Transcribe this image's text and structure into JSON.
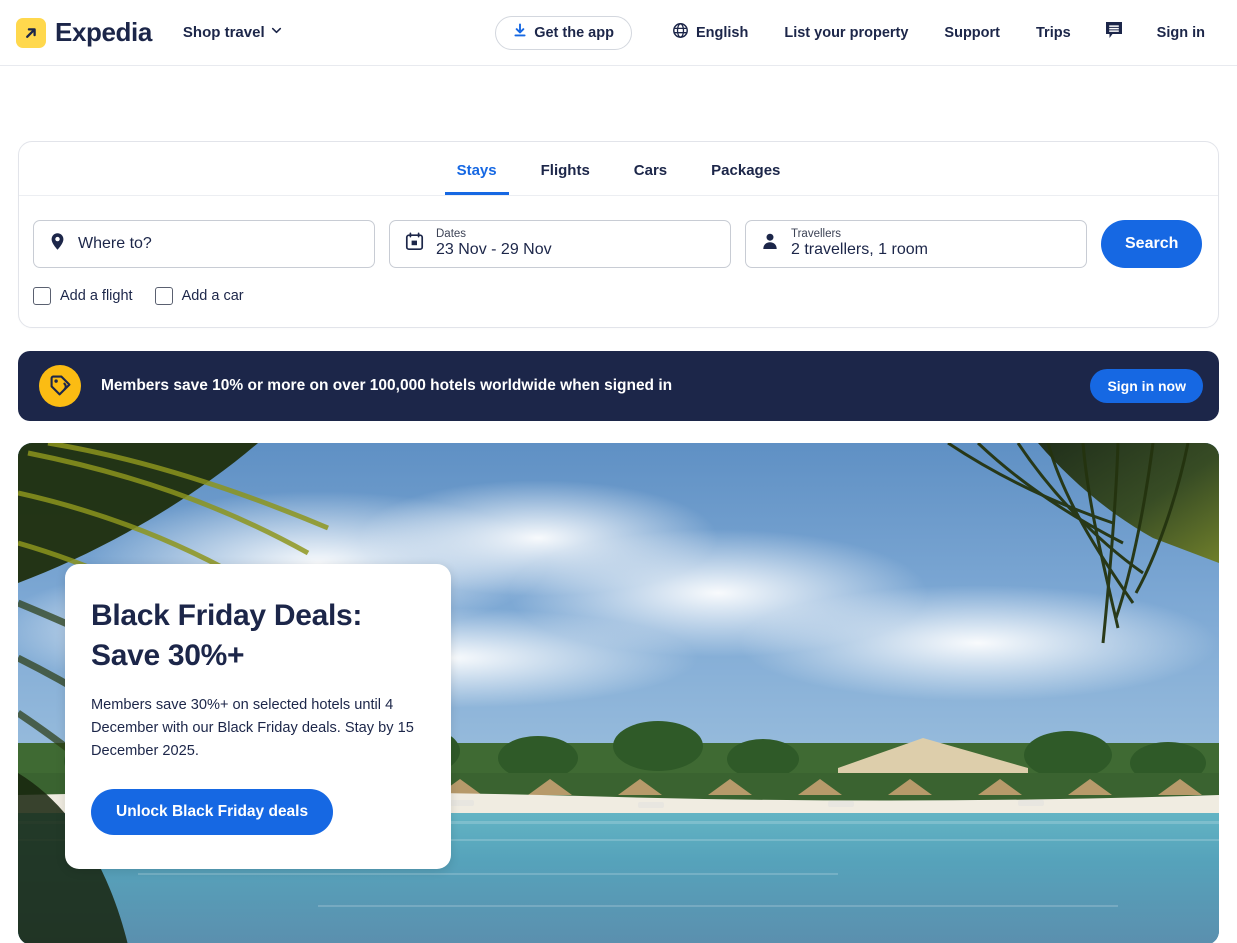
{
  "brand": {
    "name": "Expedia",
    "logo_icon": "arrow-up-right-icon",
    "logo_bg": "#ffd84d"
  },
  "header": {
    "shop_travel": "Shop travel",
    "shop_travel_icon": "chevron-down-icon",
    "get_app": "Get the app",
    "get_app_icon": "download-icon",
    "language": "English",
    "language_icon": "globe-icon",
    "list_property": "List your property",
    "support": "Support",
    "trips": "Trips",
    "messages_icon": "message-bubble-icon",
    "sign_in": "Sign in"
  },
  "search": {
    "tabs": [
      {
        "label": "Stays",
        "active": true
      },
      {
        "label": "Flights",
        "active": false
      },
      {
        "label": "Cars",
        "active": false
      },
      {
        "label": "Packages",
        "active": false
      }
    ],
    "destination": {
      "placeholder": "Where to?",
      "value": "",
      "icon": "location-pin-icon"
    },
    "dates": {
      "label": "Dates",
      "value": "23 Nov - 29 Nov",
      "icon": "calendar-icon"
    },
    "travellers": {
      "label": "Travellers",
      "value": "2 travellers, 1 room",
      "icon": "person-icon"
    },
    "search_button": "Search",
    "checkboxes": [
      {
        "label": "Add a flight",
        "checked": false
      },
      {
        "label": "Add a car",
        "checked": false
      }
    ]
  },
  "member_banner": {
    "badge_icon": "price-tag-icon",
    "text": "Members save 10% or more on over 100,000 hotels worldwide when signed in",
    "cta": "Sign in now",
    "bg": "#1c2649",
    "badge_bg": "#fbbc13"
  },
  "hero": {
    "title_line1": "Black Friday Deals:",
    "title_line2": "Save 30%+",
    "body": "Members save 30%+ on selected hotels until 4 December with our Black Friday deals. Stay by 15 December 2025.",
    "cta": "Unlock Black Friday deals",
    "image_description": "Tropical beach resort with palm fronds, white sand, thatched umbrellas and turquoise sea"
  },
  "colors": {
    "accent_blue": "#1668e3",
    "navy": "#1c2649",
    "brand_yellow": "#ffd84d"
  }
}
